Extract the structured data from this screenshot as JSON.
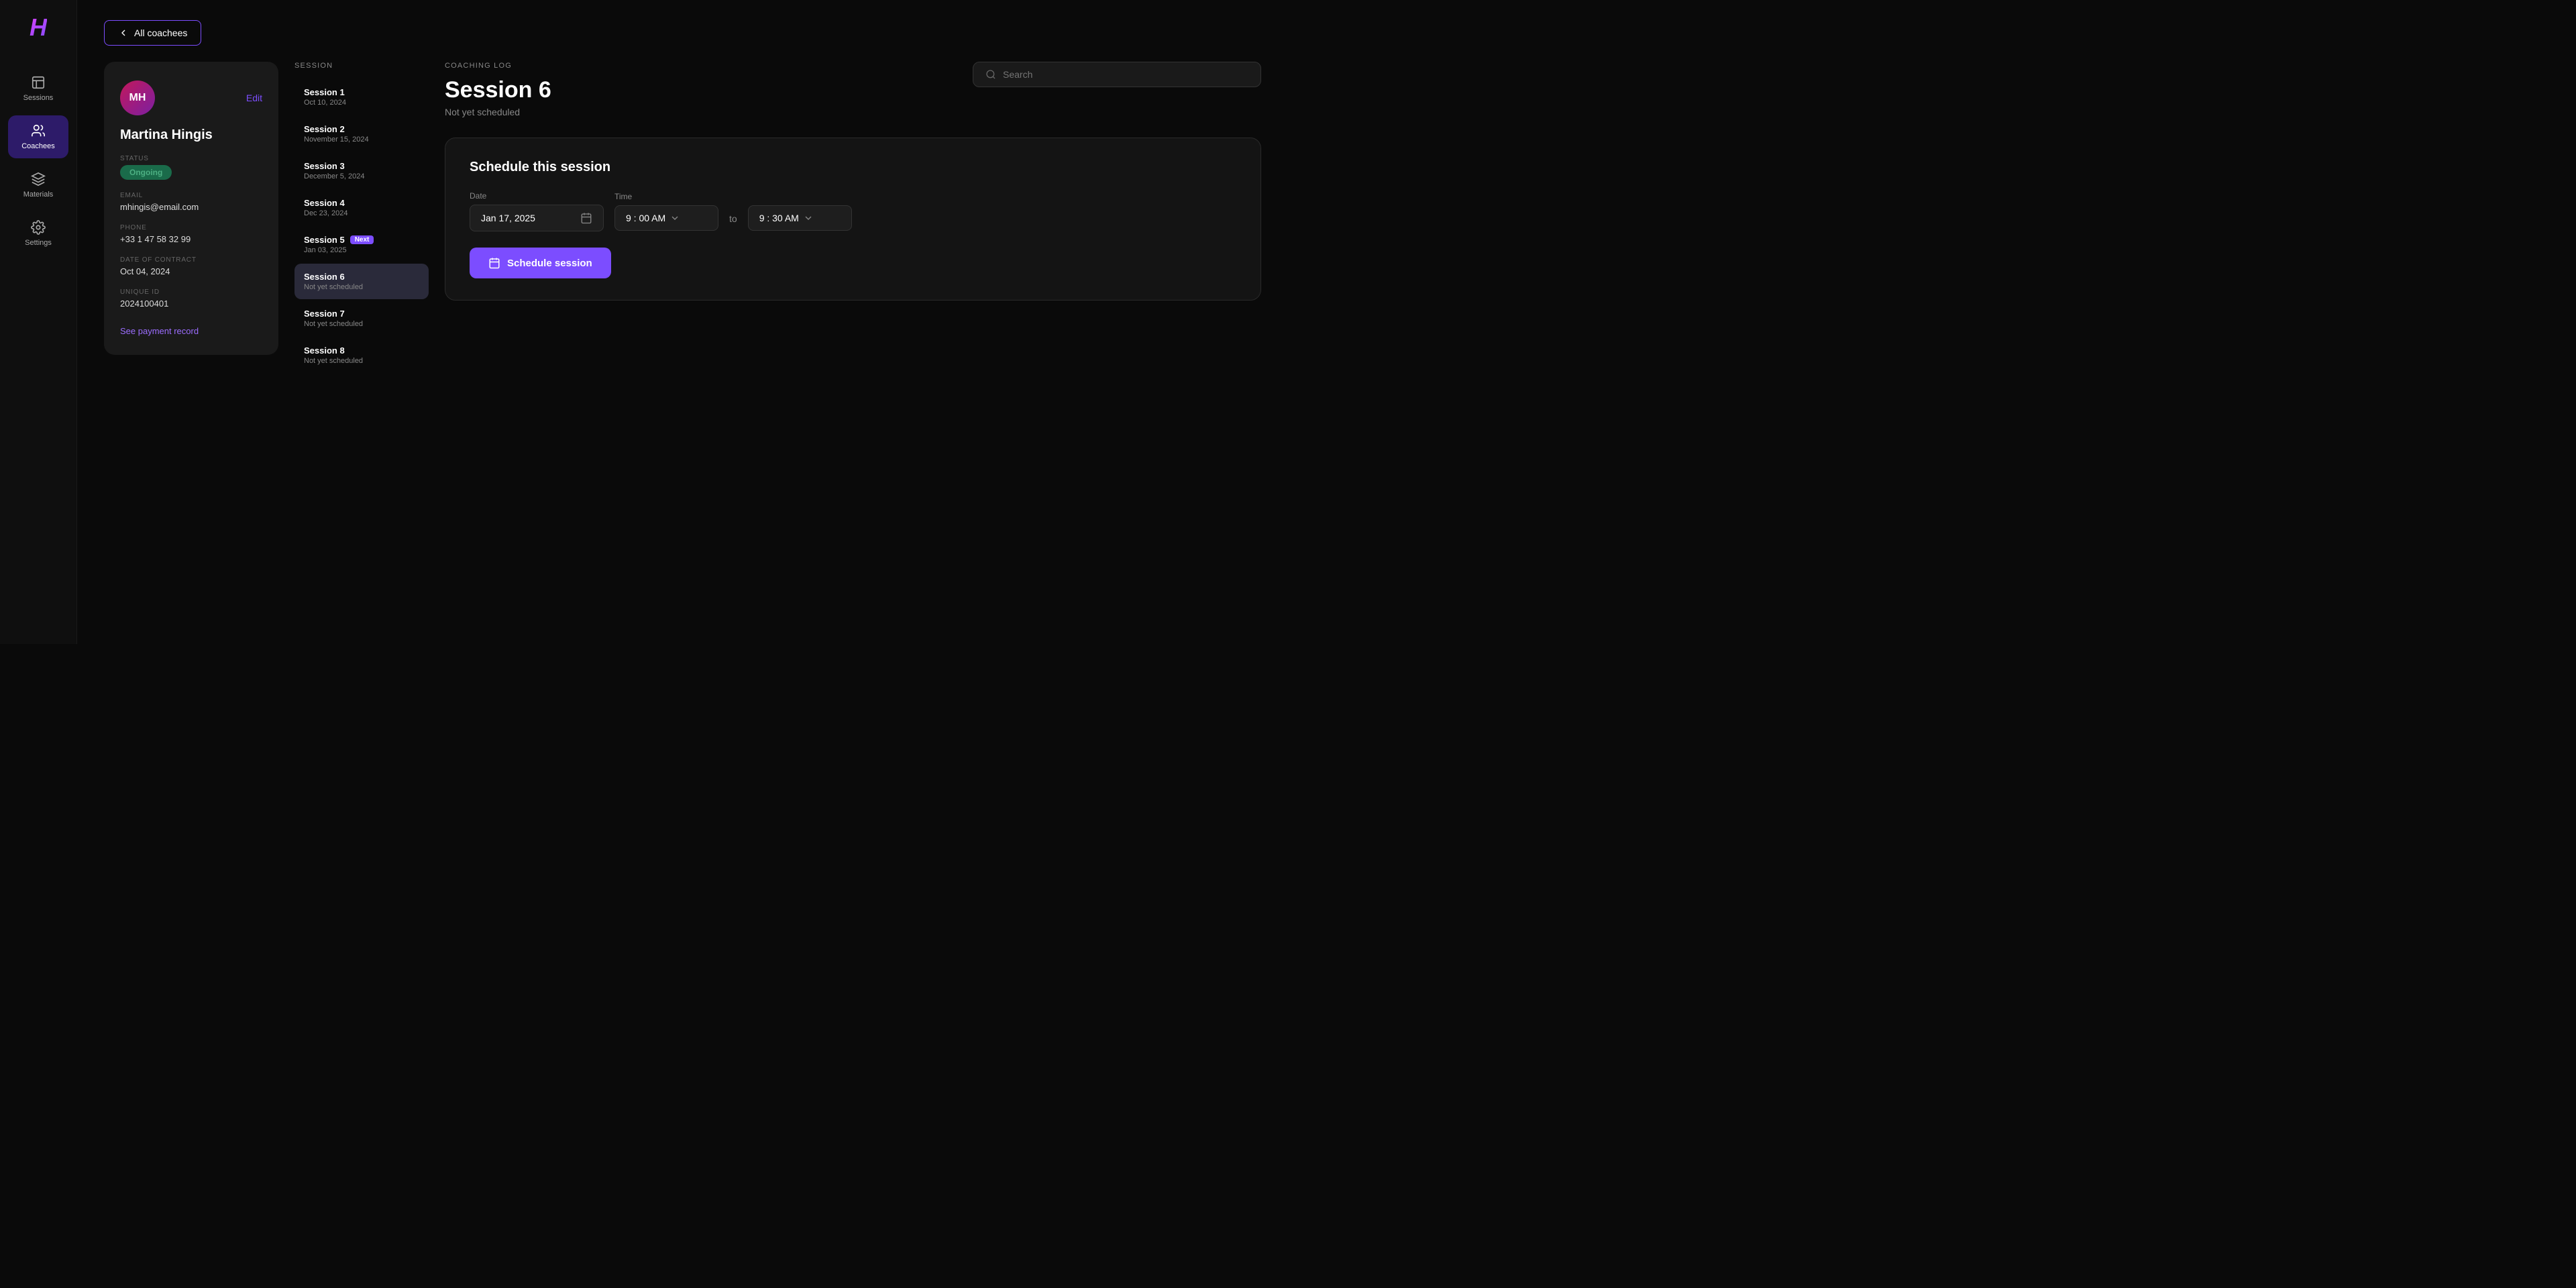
{
  "app": {
    "logo": "H",
    "nav": [
      {
        "id": "sessions",
        "label": "Sessions",
        "active": false
      },
      {
        "id": "coachees",
        "label": "Coachees",
        "active": true
      },
      {
        "id": "materials",
        "label": "Materials",
        "active": false
      },
      {
        "id": "settings",
        "label": "Settings",
        "active": false
      }
    ]
  },
  "back_button": "All coachees",
  "profile": {
    "initials": "MH",
    "name": "Martina Hingis",
    "status_label": "STATUS",
    "status": "Ongoing",
    "email_label": "EMAIL",
    "email": "mhingis@email.com",
    "phone_label": "PHONE",
    "phone": "+33 1 47 58 32 99",
    "contract_label": "DATE OF CONTRACT",
    "contract": "Oct 04, 2024",
    "id_label": "UNIQUE ID",
    "unique_id": "2024100401",
    "payment_link": "See payment record",
    "edit_label": "Edit"
  },
  "sessions_panel": {
    "header": "SESSION",
    "items": [
      {
        "name": "Session 1",
        "date": "Oct 10, 2024",
        "active": false,
        "badge": null
      },
      {
        "name": "Session 2",
        "date": "November 15, 2024",
        "active": false,
        "badge": null
      },
      {
        "name": "Session 3",
        "date": "December 5, 2024",
        "active": false,
        "badge": null
      },
      {
        "name": "Session 4",
        "date": "Dec 23, 2024",
        "active": false,
        "badge": null
      },
      {
        "name": "Session 5",
        "date": "Jan 03, 2025",
        "active": false,
        "badge": "Next"
      },
      {
        "name": "Session 6",
        "date": "Not yet scheduled",
        "active": true,
        "badge": null
      },
      {
        "name": "Session 7",
        "date": "Not yet scheduled",
        "active": false,
        "badge": null
      },
      {
        "name": "Session 8",
        "date": "Not yet scheduled",
        "active": false,
        "badge": null
      }
    ]
  },
  "coaching_log": {
    "header": "COACHING LOG",
    "session_title": "Session 6",
    "session_subtitle": "Not yet scheduled"
  },
  "search": {
    "placeholder": "Search"
  },
  "schedule": {
    "card_title": "Schedule this session",
    "date_label": "Date",
    "date_value": "Jan 17, 2025",
    "time_label": "Time",
    "time_start": "9 : 00 AM",
    "to_text": "to",
    "time_end": "9 : 30 AM",
    "button_label": "Schedule session"
  }
}
